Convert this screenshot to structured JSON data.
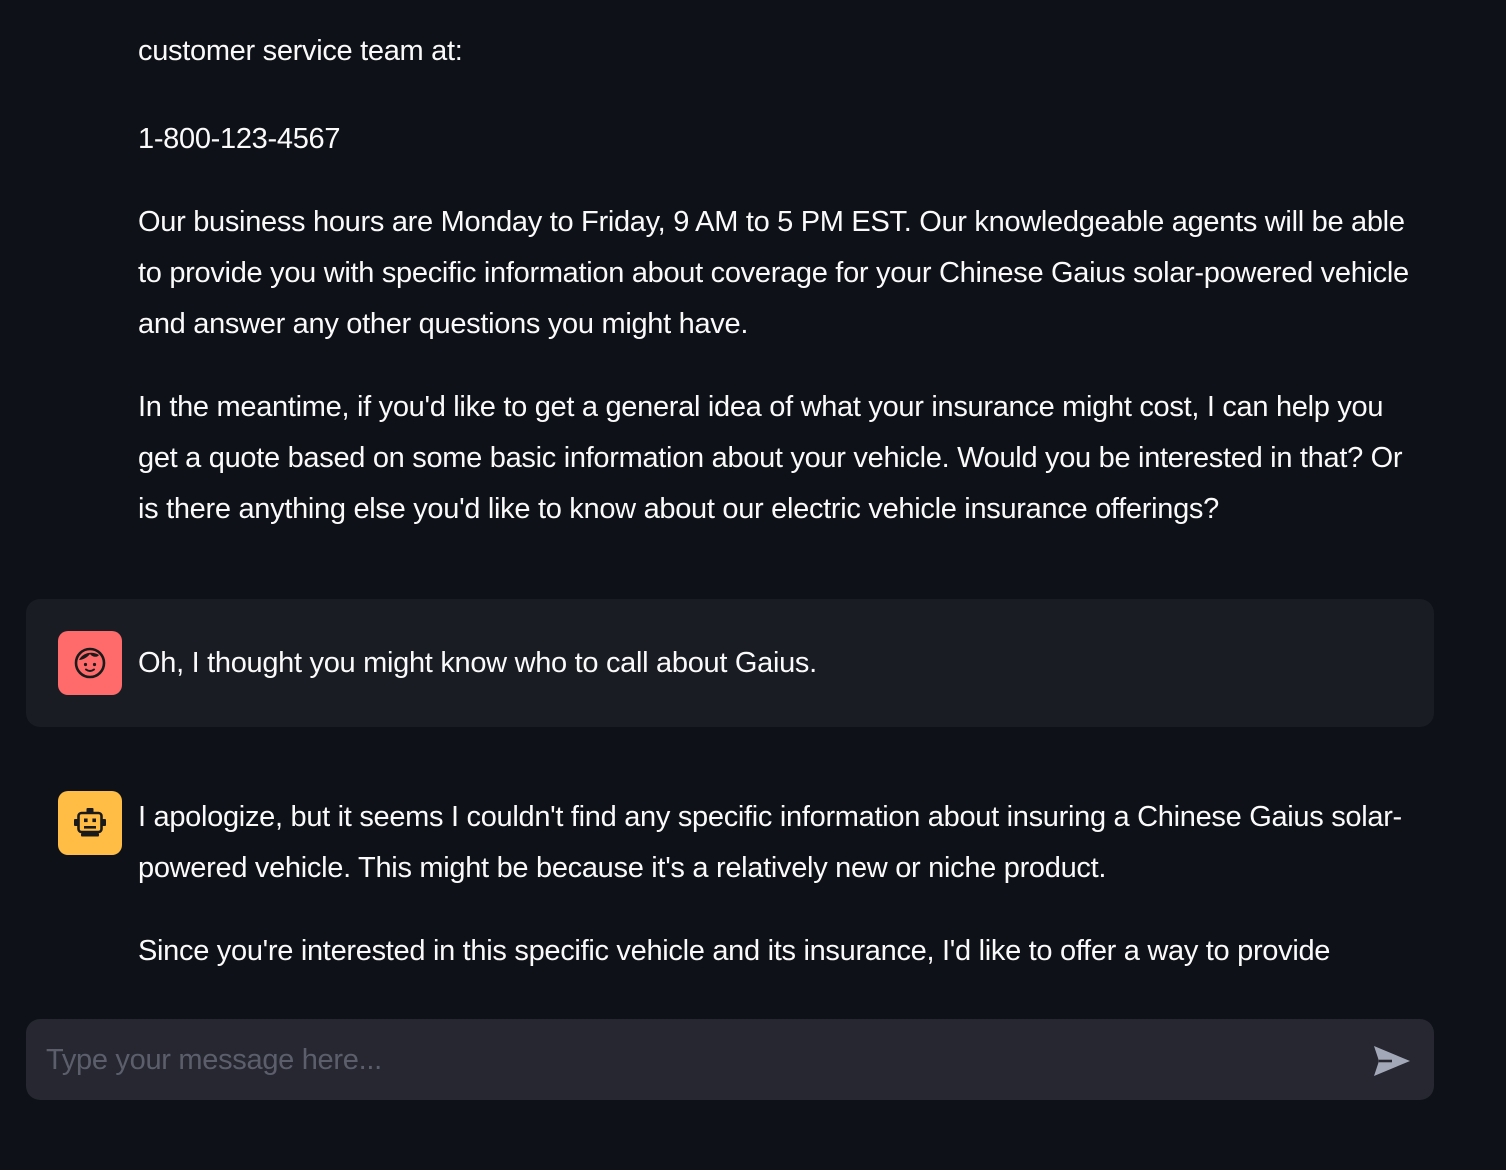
{
  "messages": {
    "assistant_prev": {
      "line_partial": "customer service team at:",
      "phone": "1-800-123-4567",
      "para_hours": "Our business hours are Monday to Friday, 9 AM to 5 PM EST. Our knowledgeable agents will be able to provide you with specific information about coverage for your Chinese Gaius solar-powered vehicle and answer any other questions you might have.",
      "para_quote": "In the meantime, if you'd like to get a general idea of what your insurance might cost, I can help you get a quote based on some basic information about your vehicle. Would you be interested in that? Or is there anything else you'd like to know about our electric vehicle insurance offerings?"
    },
    "user": {
      "text": "Oh, I thought you might know who to call about Gaius.",
      "avatar_icon": "face-icon",
      "avatar_color": "#ff6b6b"
    },
    "assistant": {
      "para_1": "I apologize, but it seems I couldn't find any specific information about insuring a Chinese Gaius solar-powered vehicle. This might be because it's a relatively new or niche product.",
      "para_2": "Since you're interested in this specific vehicle and its insurance, I'd like to offer a way to provide",
      "avatar_icon": "robot-icon",
      "avatar_color": "#ffbd45"
    }
  },
  "input": {
    "placeholder": "Type your message here...",
    "value": "",
    "send_icon": "send-icon"
  },
  "colors": {
    "background": "#0e1117",
    "user_bubble": "#1a1c24",
    "input_background": "#262730",
    "text": "#fafafa"
  }
}
